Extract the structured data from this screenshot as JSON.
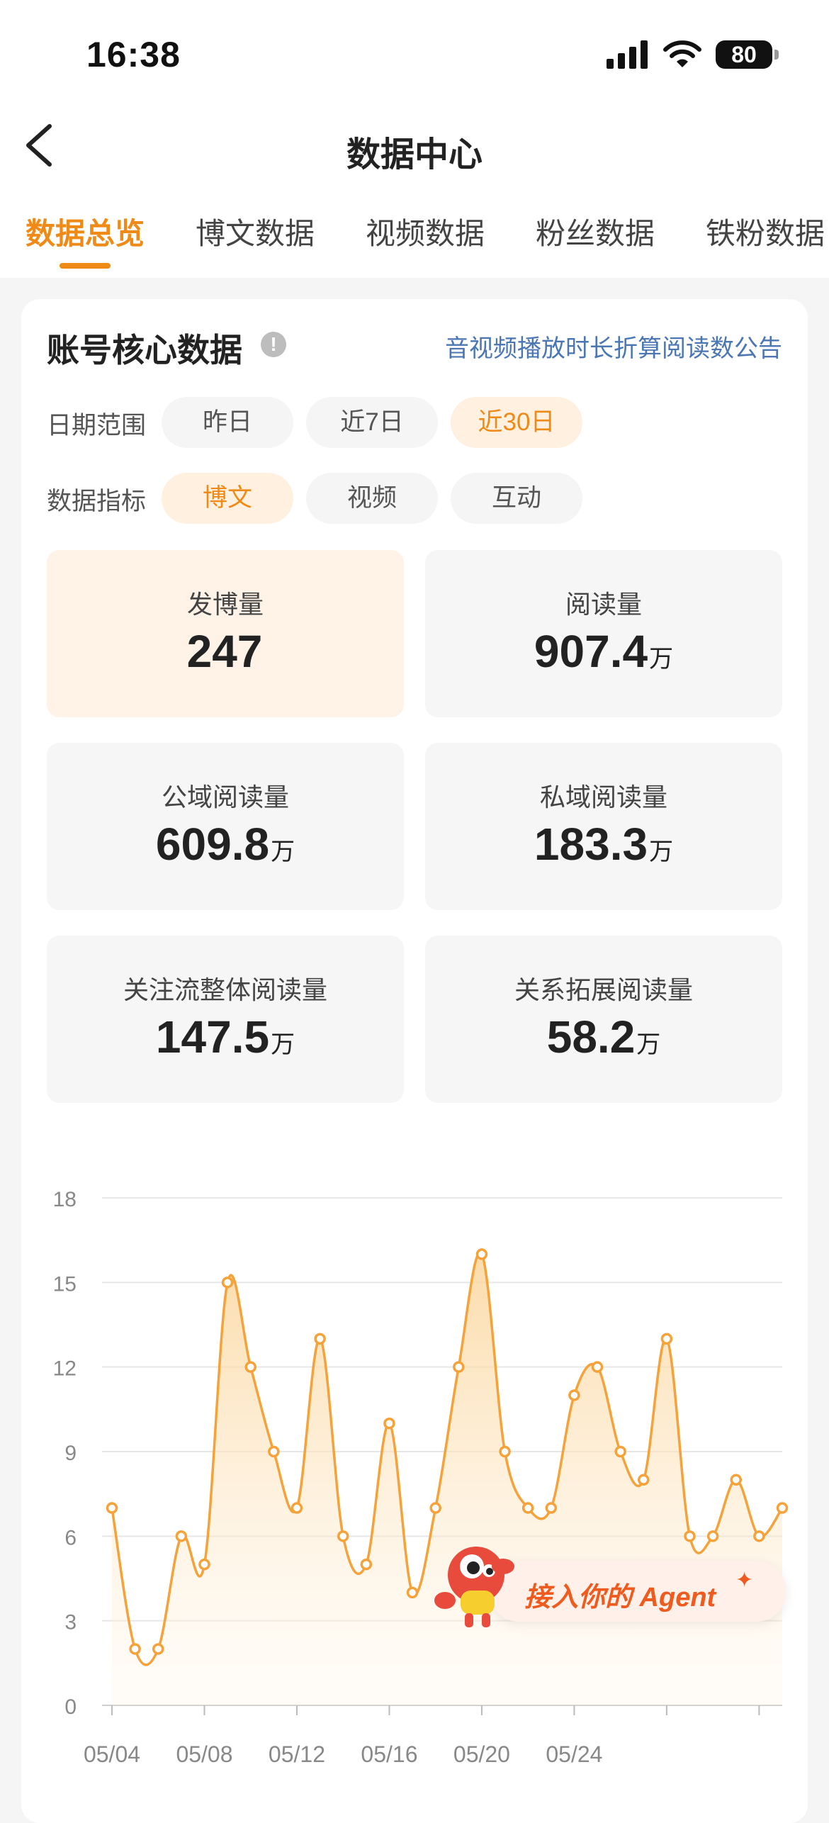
{
  "status": {
    "time": "16:38",
    "battery": "80"
  },
  "header": {
    "title": "数据中心",
    "back_icon": "chevron-left-icon"
  },
  "tabs": [
    {
      "label": "数据总览",
      "active": true
    },
    {
      "label": "博文数据",
      "active": false
    },
    {
      "label": "视频数据",
      "active": false
    },
    {
      "label": "粉丝数据",
      "active": false
    },
    {
      "label": "铁粉数据",
      "active": false
    }
  ],
  "section": {
    "title": "账号核心数据",
    "info_icon": "!",
    "notice_link": "音视频播放时长折算阅读数公告"
  },
  "date_range": {
    "label": "日期范围",
    "options": [
      "昨日",
      "近7日",
      "近30日"
    ],
    "selected": "近30日"
  },
  "metric": {
    "label": "数据指标",
    "options": [
      "博文",
      "视频",
      "互动"
    ],
    "selected": "博文"
  },
  "stats": [
    {
      "label": "发博量",
      "value": "247",
      "unit": ""
    },
    {
      "label": "阅读量",
      "value": "907.4",
      "unit": "万"
    },
    {
      "label": "公域阅读量",
      "value": "609.8",
      "unit": "万"
    },
    {
      "label": "私域阅读量",
      "value": "183.3",
      "unit": "万"
    },
    {
      "label": "关注流整体阅读量",
      "value": "147.5",
      "unit": "万"
    },
    {
      "label": "关系拓展阅读量",
      "value": "58.2",
      "unit": "万"
    }
  ],
  "chart_data": {
    "type": "area",
    "title": "",
    "xlabel": "",
    "ylabel": "",
    "x": [
      "05/04",
      "05/05",
      "05/06",
      "05/07",
      "05/08",
      "05/09",
      "05/10",
      "05/11",
      "05/12",
      "05/13",
      "05/14",
      "05/15",
      "05/16",
      "05/17",
      "05/18",
      "05/19",
      "05/20",
      "05/21",
      "05/22",
      "05/23",
      "05/24",
      "05/25",
      "05/26",
      "05/27",
      "05/28",
      "05/29",
      "05/30",
      "05/31",
      "06/01",
      "06/02"
    ],
    "x_tick_labels": [
      "05/04",
      "05/08",
      "05/12",
      "05/16",
      "05/20",
      "05/24"
    ],
    "series": [
      {
        "values": [
          7,
          2,
          2,
          6,
          5,
          15,
          12,
          9,
          7,
          13,
          6,
          5,
          10,
          4,
          7,
          12,
          16,
          9,
          7,
          7,
          11,
          12,
          9,
          8,
          13,
          6,
          6,
          8,
          6,
          7
        ]
      }
    ],
    "y_ticks": [
      0,
      3,
      6,
      9,
      12,
      15,
      18
    ],
    "ylim": [
      0,
      18
    ],
    "grid": true,
    "color": "#f5a23a"
  },
  "agent_banner": {
    "text": "接入你的 Agent",
    "sparkle": "✦"
  }
}
